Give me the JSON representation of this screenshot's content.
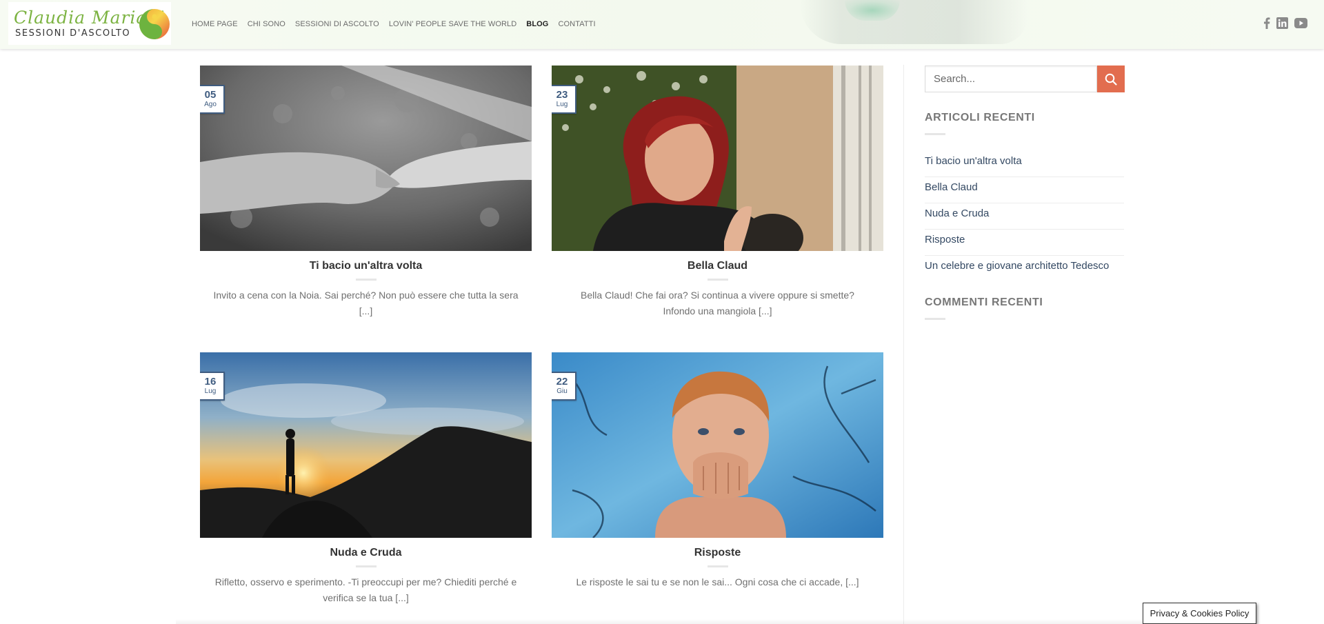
{
  "header": {
    "logo": {
      "script": "Claudia Mariani",
      "subtitle": "SESSIONI D'ASCOLTO"
    },
    "nav": [
      {
        "label": "HOME PAGE",
        "active": false
      },
      {
        "label": "CHI SONO",
        "active": false
      },
      {
        "label": "SESSIONI DI ASCOLTO",
        "active": false
      },
      {
        "label": "LOVIN' PEOPLE SAVE THE WORLD",
        "active": false
      },
      {
        "label": "BLOG",
        "active": true
      },
      {
        "label": "CONTATTI",
        "active": false
      }
    ],
    "social": [
      "facebook-icon",
      "linkedin-icon",
      "youtube-icon"
    ]
  },
  "posts": [
    {
      "day": "05",
      "month": "Ago",
      "title": "Ti bacio un'altra volta",
      "excerpt": "Invito a cena con la Noia. Sai perché? Non può essere che tutta la sera [...]",
      "image": "holding-hands-bw"
    },
    {
      "day": "23",
      "month": "Lug",
      "title": "Bella Claud",
      "excerpt": "Bella Claud! Che fai ora? Si continua a vivere oppure si smette? Infondo una mangiola [...]",
      "image": "red-haired-woman"
    },
    {
      "day": "16",
      "month": "Lug",
      "title": "Nuda e Cruda",
      "excerpt": "Rifletto, osservo e sperimento. -Ti preoccupi per me? Chiediti perché e verifica se la tua [...]",
      "image": "sunset-silhouette"
    },
    {
      "day": "22",
      "month": "Giu",
      "title": "Risposte",
      "excerpt": "Le risposte le sai tu e se non le sai... Ogni cosa che ci accade, [...]",
      "image": "man-blue-background"
    }
  ],
  "sidebar": {
    "search_placeholder": "Search...",
    "recent_title": "ARTICOLI RECENTI",
    "recent": [
      "Ti bacio un'altra volta",
      "Bella Claud",
      "Nuda e Cruda",
      "Risposte",
      "Un celebre e giovane architetto Tedesco"
    ],
    "comments_title": "COMMENTI RECENTI"
  },
  "cookie_badge": "Privacy & Cookies Policy",
  "colors": {
    "accent": "#e26d4f",
    "link": "#334862",
    "badge": "#3f5c80",
    "logo_green": "#7cb342"
  }
}
